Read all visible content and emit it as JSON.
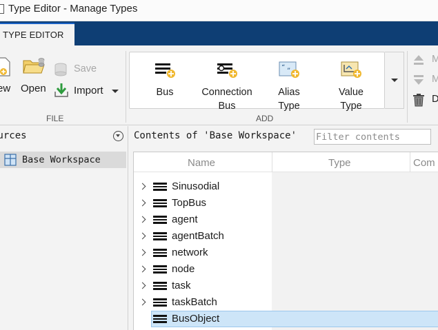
{
  "window": {
    "title": "Type Editor - Manage Types"
  },
  "ribbon": {
    "active_tab": "TYPE EDITOR",
    "file_group": {
      "label": "FILE",
      "new_label": "ew",
      "open_label": "Open",
      "save_label": "Save",
      "import_label": "Import"
    },
    "add_group": {
      "label": "ADD",
      "buttons": [
        {
          "line1": "Bus",
          "line2": ""
        },
        {
          "line1": "Connection",
          "line2": "Bus"
        },
        {
          "line1": "Alias",
          "line2": "Type"
        },
        {
          "line1": "Value",
          "line2": "Type"
        }
      ]
    },
    "edit_group": {
      "move_up_label": "M",
      "move_down_label": "M",
      "delete_label": "D"
    }
  },
  "sources": {
    "header": "ources",
    "items": [
      {
        "label": "Base Workspace"
      }
    ]
  },
  "contents": {
    "title": "Contents of 'Base Workspace'",
    "filter_placeholder": "Filter contents",
    "columns": [
      "Name",
      "Type",
      "Com"
    ],
    "rows": [
      {
        "name": "Sinusodial",
        "expandable": true
      },
      {
        "name": "TopBus",
        "expandable": true
      },
      {
        "name": "agent",
        "expandable": true
      },
      {
        "name": "agentBatch",
        "expandable": true
      },
      {
        "name": "network",
        "expandable": true
      },
      {
        "name": "node",
        "expandable": true
      },
      {
        "name": "task",
        "expandable": true
      },
      {
        "name": "taskBatch",
        "expandable": true
      },
      {
        "name": "BusObject",
        "expandable": false,
        "selected": true
      }
    ]
  },
  "colors": {
    "tabstrip": "#0e3e74",
    "selection": "#cde5f8",
    "icon_accent": "#f0b830"
  }
}
